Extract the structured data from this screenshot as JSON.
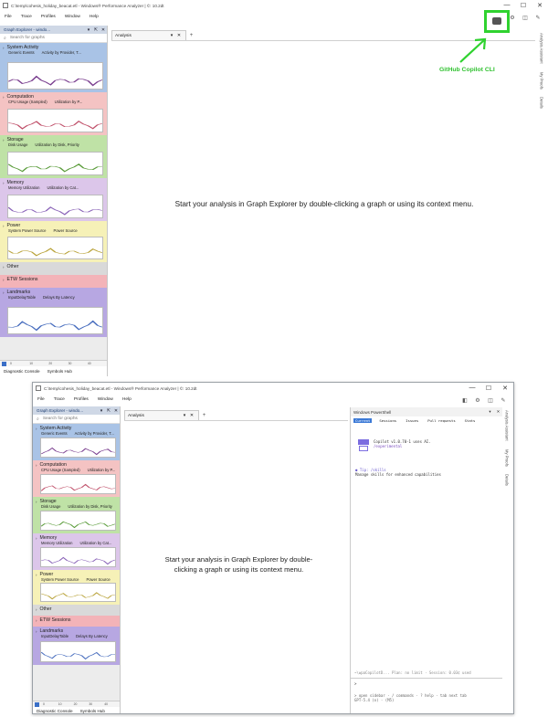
{
  "window": {
    "title": "C:\\temp\\cohesis_holiday_beacat.etl - Windows® Performance Analyzer | ©: 10.2dt",
    "title_lower": "C:\\temp\\cohesis_holiday_beacat.etl - Windows® Performance Analyzer | ©: 10.2dt",
    "controls": [
      "—",
      "☐",
      "✕"
    ]
  },
  "menu": [
    "File",
    "Trace",
    "Profiles",
    "Window",
    "Help"
  ],
  "toolbar_icons": [
    "copilot-icon",
    "settings-icon",
    "layout-icon",
    "brush-icon"
  ],
  "graph_explorer": {
    "title": "Graph Explorer - windo...",
    "header_controls": [
      "▾",
      "⇱",
      "✕"
    ],
    "search_placeholder": "Search for graphs",
    "categories": [
      {
        "name": "System Activity",
        "subs": [
          "Generic Events",
          "Activity by Provider, T..."
        ],
        "color": "#a9c3e6"
      },
      {
        "name": "Computation",
        "subs": [
          "CPU Usage (Sampled)",
          "Utilization by P..."
        ],
        "color": "#f4c3c3"
      },
      {
        "name": "Storage",
        "subs": [
          "Disk Usage",
          "Utilization by Disk, Priority"
        ],
        "color": "#bfe2a6"
      },
      {
        "name": "Memory",
        "subs": [
          "Memory Utilization",
          "Utilization by Cat..."
        ],
        "color": "#dcc6ea"
      },
      {
        "name": "Power",
        "subs": [
          "System Power Source",
          "Power Source"
        ],
        "color": "#f6f1b7"
      },
      {
        "name": "Other",
        "subs": [],
        "color": "#d9d9d9"
      },
      {
        "name": "ETW Sessions",
        "subs": [],
        "color": "#f3b3b8"
      },
      {
        "name": "Landmarks",
        "subs": [
          "InputDelayTable",
          "Delays By Latency"
        ],
        "color": "#b7a7e2"
      }
    ],
    "timeline_ticks": [
      "0",
      "10",
      "20",
      "30",
      "40"
    ],
    "bottom_tabs": [
      "Diagnostic Console",
      "Symbols Hub"
    ]
  },
  "analysis_tab": {
    "label": "Analysis",
    "dropdown": "▾",
    "close": "✕",
    "add": "+"
  },
  "center_message": "Start your analysis in Graph Explorer by double-clicking a graph or using its context menu.",
  "center_message_lines": [
    "Start your analysis in Graph Explorer by double-",
    "clicking a graph or using its context menu."
  ],
  "right_rail": [
    "Analysis Assistant",
    "My Proofs",
    "Details"
  ],
  "annotation": {
    "label": "GitHub Copilot CLI",
    "color": "#2fd22f"
  },
  "terminal": {
    "title": "Windows PowerShell",
    "tabs": [
      "Current",
      "Sessions",
      "Issues",
      "Pull requests",
      "Stats"
    ],
    "logo_line1": "Copilot v1.0.70-1 uses AI.",
    "logo_line2": "/experimental",
    "tip_line1": "● Tip: /skills",
    "tip_line2": "  Manage skills for enhanced capabilities",
    "status_line": "~\\wpaCopilotD... Plan: no limit · Session: 0.03¢ used",
    "prompt": ">",
    "help_line1": "> open sidebar · / commands · ? help · tab next tab",
    "help_line2": "GPT-5.4 (o) · (M5)"
  }
}
